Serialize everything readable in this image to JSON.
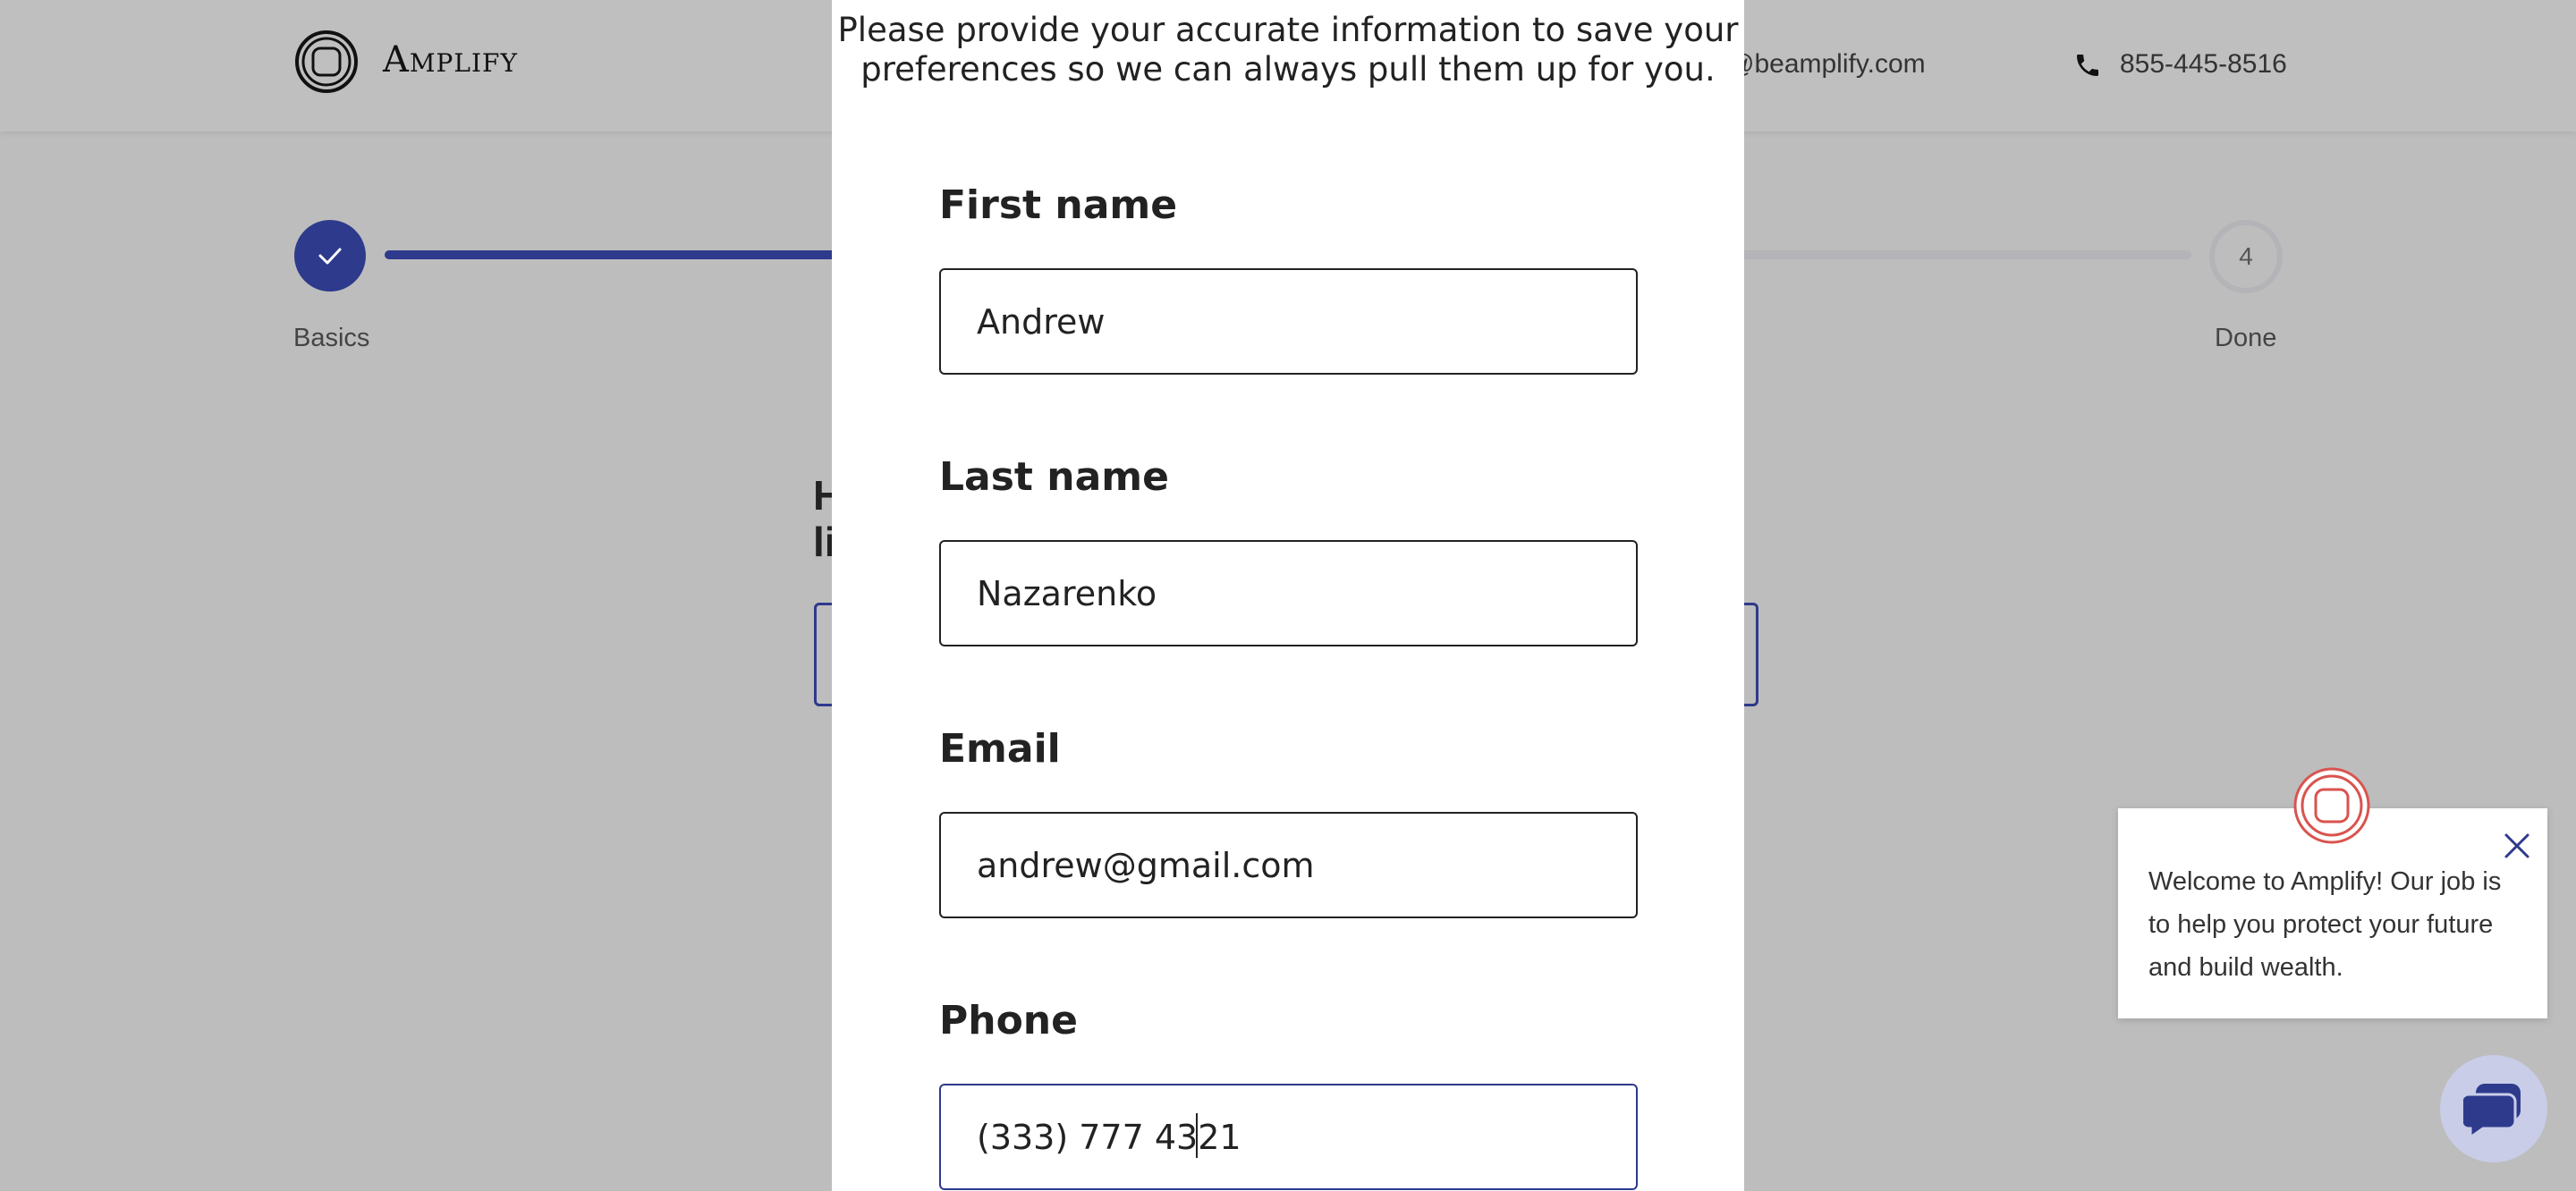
{
  "header": {
    "brand": "Amplify",
    "email": "m@beamplify.com",
    "phone": "855-445-8516"
  },
  "progress": {
    "steps": [
      {
        "label": "Basics",
        "status": "complete"
      },
      {
        "label": "Done",
        "number": "4",
        "status": "pending"
      }
    ],
    "fill_fraction": 0.28,
    "accent_color": "#2e3a8c"
  },
  "background": {
    "question_fragment_line1": "H",
    "question_fragment_line2": "li"
  },
  "modal": {
    "intro": "Please provide your accurate information to save your preferences so we can always pull them up for you.",
    "fields": [
      {
        "label": "First name",
        "value": "Andrew"
      },
      {
        "label": "Last name",
        "value": "Nazarenko"
      },
      {
        "label": "Email",
        "value": "andrew@gmail.com"
      },
      {
        "label": "Phone",
        "value": "(333) 777 4321",
        "focused": true
      }
    ]
  },
  "chat": {
    "message": "Welcome to Amplify! Our job is to help you protect your future and build wealth.",
    "icons": [
      "amplify-logo-icon",
      "close-icon",
      "chat-bubble-icon"
    ]
  }
}
